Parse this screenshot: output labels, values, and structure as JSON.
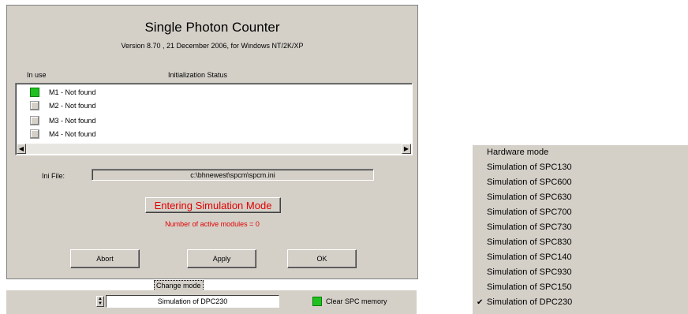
{
  "dialog": {
    "title": "Single Photon Counter",
    "version": "Version 8.70 , 21 December 2006, for Windows NT/2K/XP",
    "col_in_use": "In use",
    "col_status": "Initialization Status",
    "modules": [
      {
        "label": "M1 -  Not found",
        "in_use": true
      },
      {
        "label": "M2 -  Not found",
        "in_use": false
      },
      {
        "label": "M3 -  Not found",
        "in_use": false
      },
      {
        "label": "M4 -  Not found",
        "in_use": false
      }
    ],
    "ini_label": "Ini File:",
    "ini_value": "c:\\bhnewest\\spcm\\spcm.ini",
    "sim_mode_label": "Entering Simulation Mode",
    "active_modules": "Number of active modules = 0",
    "buttons": {
      "abort": "Abort",
      "apply": "Apply",
      "ok": "OK"
    },
    "change_mode": "Change mode",
    "mode_value": "Simulation of DPC230",
    "clear_memory": "Clear SPC memory",
    "accent_red": "#e00000",
    "check_green": "#20c020"
  },
  "mode_menu": {
    "items": [
      "Hardware mode",
      "Simulation of SPC130",
      "Simulation of SPC600",
      "Simulation of SPC630",
      "Simulation of SPC700",
      "Simulation of SPC730",
      "Simulation of SPC830",
      "Simulation of SPC140",
      "Simulation of SPC930",
      "Simulation of SPC150",
      "Simulation of DPC230"
    ],
    "checked_index": 10,
    "check_mark": "✔"
  }
}
